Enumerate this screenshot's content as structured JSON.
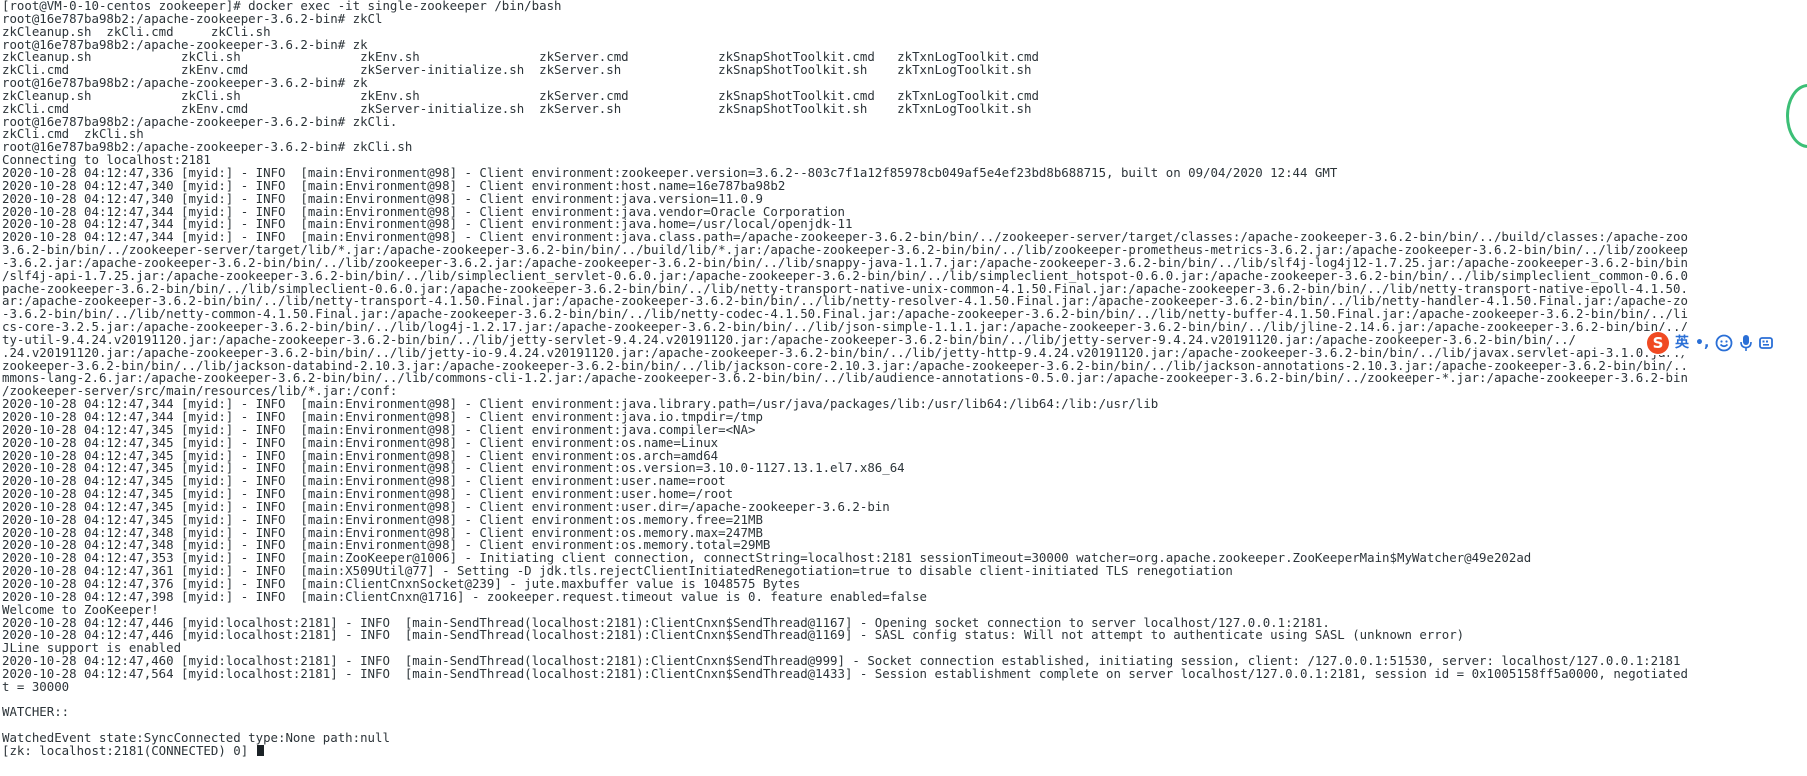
{
  "terminal": {
    "lines": [
      "[root@VM-0-10-centos zookeeper]# docker exec -it single-zookeeper /bin/bash",
      "root@16e787ba98b2:/apache-zookeeper-3.6.2-bin# zkCl",
      "zkCleanup.sh  zkCli.cmd     zkCli.sh",
      "root@16e787ba98b2:/apache-zookeeper-3.6.2-bin# zk",
      "zkCleanup.sh            zkCli.sh                zkEnv.sh                zkServer.cmd            zkSnapShotToolkit.cmd   zkTxnLogToolkit.cmd",
      "zkCli.cmd               zkEnv.cmd               zkServer-initialize.sh  zkServer.sh             zkSnapShotToolkit.sh    zkTxnLogToolkit.sh",
      "root@16e787ba98b2:/apache-zookeeper-3.6.2-bin# zk",
      "zkCleanup.sh            zkCli.sh                zkEnv.sh                zkServer.cmd            zkSnapShotToolkit.cmd   zkTxnLogToolkit.cmd",
      "zkCli.cmd               zkEnv.cmd               zkServer-initialize.sh  zkServer.sh             zkSnapShotToolkit.sh    zkTxnLogToolkit.sh",
      "root@16e787ba98b2:/apache-zookeeper-3.6.2-bin# zkCli.",
      "zkCli.cmd  zkCli.sh",
      "root@16e787ba98b2:/apache-zookeeper-3.6.2-bin# zkCli.sh",
      "Connecting to localhost:2181",
      "2020-10-28 04:12:47,336 [myid:] - INFO  [main:Environment@98] - Client environment:zookeeper.version=3.6.2--803c7f1a12f85978cb049af5e4ef23bd8b688715, built on 09/04/2020 12:44 GMT",
      "2020-10-28 04:12:47,340 [myid:] - INFO  [main:Environment@98] - Client environment:host.name=16e787ba98b2",
      "2020-10-28 04:12:47,340 [myid:] - INFO  [main:Environment@98] - Client environment:java.version=11.0.9",
      "2020-10-28 04:12:47,344 [myid:] - INFO  [main:Environment@98] - Client environment:java.vendor=Oracle Corporation",
      "2020-10-28 04:12:47,344 [myid:] - INFO  [main:Environment@98] - Client environment:java.home=/usr/local/openjdk-11",
      "2020-10-28 04:12:47,344 [myid:] - INFO  [main:Environment@98] - Client environment:java.class.path=/apache-zookeeper-3.6.2-bin/bin/../zookeeper-server/target/classes:/apache-zookeeper-3.6.2-bin/bin/../build/classes:/apache-zoo",
      "3.6.2-bin/bin/../zookeeper-server/target/lib/*.jar:/apache-zookeeper-3.6.2-bin/bin/../build/lib/*.jar:/apache-zookeeper-3.6.2-bin/bin/../lib/zookeeper-prometheus-metrics-3.6.2.jar:/apache-zookeeper-3.6.2-bin/bin/../lib/zookeep",
      "-3.6.2.jar:/apache-zookeeper-3.6.2-bin/bin/../lib/zookeeper-3.6.2.jar:/apache-zookeeper-3.6.2-bin/bin/../lib/snappy-java-1.1.7.jar:/apache-zookeeper-3.6.2-bin/bin/../lib/slf4j-log4j12-1.7.25.jar:/apache-zookeeper-3.6.2-bin/bin",
      "/slf4j-api-1.7.25.jar:/apache-zookeeper-3.6.2-bin/bin/../lib/simpleclient_servlet-0.6.0.jar:/apache-zookeeper-3.6.2-bin/bin/../lib/simpleclient_hotspot-0.6.0.jar:/apache-zookeeper-3.6.2-bin/bin/../lib/simpleclient_common-0.6.0",
      "pache-zookeeper-3.6.2-bin/bin/../lib/simpleclient-0.6.0.jar:/apache-zookeeper-3.6.2-bin/bin/../lib/netty-transport-native-unix-common-4.1.50.Final.jar:/apache-zookeeper-3.6.2-bin/bin/../lib/netty-transport-native-epoll-4.1.50.",
      "ar:/apache-zookeeper-3.6.2-bin/bin/../lib/netty-transport-4.1.50.Final.jar:/apache-zookeeper-3.6.2-bin/bin/../lib/netty-resolver-4.1.50.Final.jar:/apache-zookeeper-3.6.2-bin/bin/../lib/netty-handler-4.1.50.Final.jar:/apache-zo",
      "-3.6.2-bin/bin/../lib/netty-common-4.1.50.Final.jar:/apache-zookeeper-3.6.2-bin/bin/../lib/netty-codec-4.1.50.Final.jar:/apache-zookeeper-3.6.2-bin/bin/../lib/netty-buffer-4.1.50.Final.jar:/apache-zookeeper-3.6.2-bin/bin/../li",
      "cs-core-3.2.5.jar:/apache-zookeeper-3.6.2-bin/bin/../lib/log4j-1.2.17.jar:/apache-zookeeper-3.6.2-bin/bin/../lib/json-simple-1.1.1.jar:/apache-zookeeper-3.6.2-bin/bin/../lib/jline-2.14.6.jar:/apache-zookeeper-3.6.2-bin/bin/../",
      "ty-util-9.4.24.v20191120.jar:/apache-zookeeper-3.6.2-bin/bin/../lib/jetty-servlet-9.4.24.v20191120.jar:/apache-zookeeper-3.6.2-bin/bin/../lib/jetty-server-9.4.24.v20191120.jar:/apache-zookeeper-3.6.2-bin/bin/../",
      ".24.v20191120.jar:/apache-zookeeper-3.6.2-bin/bin/../lib/jetty-io-9.4.24.v20191120.jar:/apache-zookeeper-3.6.2-bin/bin/../lib/jetty-http-9.4.24.v20191120.jar:/apache-zookeeper-3.6.2-bin/bin/../lib/javax.servlet-api-3.1.0.jar:/",
      "zookeeper-3.6.2-bin/bin/../lib/jackson-databind-2.10.3.jar:/apache-zookeeper-3.6.2-bin/bin/../lib/jackson-core-2.10.3.jar:/apache-zookeeper-3.6.2-bin/bin/../lib/jackson-annotations-2.10.3.jar:/apache-zookeeper-3.6.2-bin/bin/..",
      "mmons-lang-2.6.jar:/apache-zookeeper-3.6.2-bin/bin/../lib/commons-cli-1.2.jar:/apache-zookeeper-3.6.2-bin/bin/../lib/audience-annotations-0.5.0.jar:/apache-zookeeper-3.6.2-bin/bin/../zookeeper-*.jar:/apache-zookeeper-3.6.2-bin",
      "/zookeeper-server/src/main/resources/lib/*.jar:/conf:",
      "2020-10-28 04:12:47,344 [myid:] - INFO  [main:Environment@98] - Client environment:java.library.path=/usr/java/packages/lib:/usr/lib64:/lib64:/lib:/usr/lib",
      "2020-10-28 04:12:47,344 [myid:] - INFO  [main:Environment@98] - Client environment:java.io.tmpdir=/tmp",
      "2020-10-28 04:12:47,345 [myid:] - INFO  [main:Environment@98] - Client environment:java.compiler=<NA>",
      "2020-10-28 04:12:47,345 [myid:] - INFO  [main:Environment@98] - Client environment:os.name=Linux",
      "2020-10-28 04:12:47,345 [myid:] - INFO  [main:Environment@98] - Client environment:os.arch=amd64",
      "2020-10-28 04:12:47,345 [myid:] - INFO  [main:Environment@98] - Client environment:os.version=3.10.0-1127.13.1.el7.x86_64",
      "2020-10-28 04:12:47,345 [myid:] - INFO  [main:Environment@98] - Client environment:user.name=root",
      "2020-10-28 04:12:47,345 [myid:] - INFO  [main:Environment@98] - Client environment:user.home=/root",
      "2020-10-28 04:12:47,345 [myid:] - INFO  [main:Environment@98] - Client environment:user.dir=/apache-zookeeper-3.6.2-bin",
      "2020-10-28 04:12:47,345 [myid:] - INFO  [main:Environment@98] - Client environment:os.memory.free=21MB",
      "2020-10-28 04:12:47,348 [myid:] - INFO  [main:Environment@98] - Client environment:os.memory.max=247MB",
      "2020-10-28 04:12:47,348 [myid:] - INFO  [main:Environment@98] - Client environment:os.memory.total=29MB",
      "2020-10-28 04:12:47,353 [myid:] - INFO  [main:ZooKeeper@1006] - Initiating client connection, connectString=localhost:2181 sessionTimeout=30000 watcher=org.apache.zookeeper.ZooKeeperMain$MyWatcher@49e202ad",
      "2020-10-28 04:12:47,361 [myid:] - INFO  [main:X509Util@77] - Setting -D jdk.tls.rejectClientInitiatedRenegotiation=true to disable client-initiated TLS renegotiation",
      "2020-10-28 04:12:47,376 [myid:] - INFO  [main:ClientCnxnSocket@239] - jute.maxbuffer value is 1048575 Bytes",
      "2020-10-28 04:12:47,398 [myid:] - INFO  [main:ClientCnxn@1716] - zookeeper.request.timeout value is 0. feature enabled=false",
      "Welcome to ZooKeeper!",
      "2020-10-28 04:12:47,446 [myid:localhost:2181] - INFO  [main-SendThread(localhost:2181):ClientCnxn$SendThread@1167] - Opening socket connection to server localhost/127.0.0.1:2181.",
      "2020-10-28 04:12:47,446 [myid:localhost:2181] - INFO  [main-SendThread(localhost:2181):ClientCnxn$SendThread@1169] - SASL config status: Will not attempt to authenticate using SASL (unknown error)",
      "JLine support is enabled",
      "2020-10-28 04:12:47,460 [myid:localhost:2181] - INFO  [main-SendThread(localhost:2181):ClientCnxn$SendThread@999] - Socket connection established, initiating session, client: /127.0.0.1:51530, server: localhost/127.0.0.1:2181",
      "2020-10-28 04:12:47,564 [myid:localhost:2181] - INFO  [main-SendThread(localhost:2181):ClientCnxn$SendThread@1433] - Session establishment complete on server localhost/127.0.0.1:2181, session id = 0x1005158ff5a0000, negotiated",
      "t = 30000",
      "",
      "WATCHER::",
      "",
      "WatchedEvent state:SyncConnected type:None path:null"
    ],
    "prompt": "[zk: localhost:2181(CONNECTED) 0] "
  },
  "ime_toolbar": {
    "logo": "S",
    "lang_label": "英",
    "punct_label": "•,",
    "icons": [
      "emoji-icon",
      "microphone-icon",
      "keyboard-icon"
    ]
  },
  "colors": {
    "text": "#2c3439",
    "background": "#ffffff",
    "ime_accent": "#2a6fd6",
    "ime_logo": "#f04a22",
    "widget_ring": "#3cbf76"
  }
}
